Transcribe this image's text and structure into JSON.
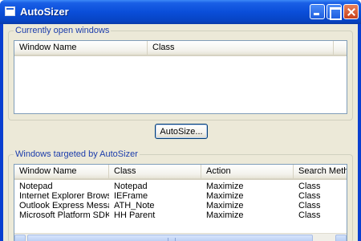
{
  "window": {
    "title": "AutoSizer"
  },
  "open_windows": {
    "group_label": "Currently open windows",
    "columns": [
      "Window Name",
      "Class"
    ]
  },
  "autosize_button": {
    "label": "AutoSize..."
  },
  "targeted": {
    "group_label": "Windows targeted by AutoSizer",
    "columns": [
      "Window Name",
      "Class",
      "Action",
      "Search Meth"
    ],
    "rows": [
      [
        "Notepad",
        "Notepad",
        "Maximize",
        "Class"
      ],
      [
        "Internet Explorer Browser",
        "IEFrame",
        "Maximize",
        "Class"
      ],
      [
        "Outlook Express Message",
        "ATH_Note",
        "Maximize",
        "Class"
      ],
      [
        "Microsoft Platform SDK, ...",
        "HH Parent",
        "Maximize",
        "Class"
      ]
    ]
  }
}
